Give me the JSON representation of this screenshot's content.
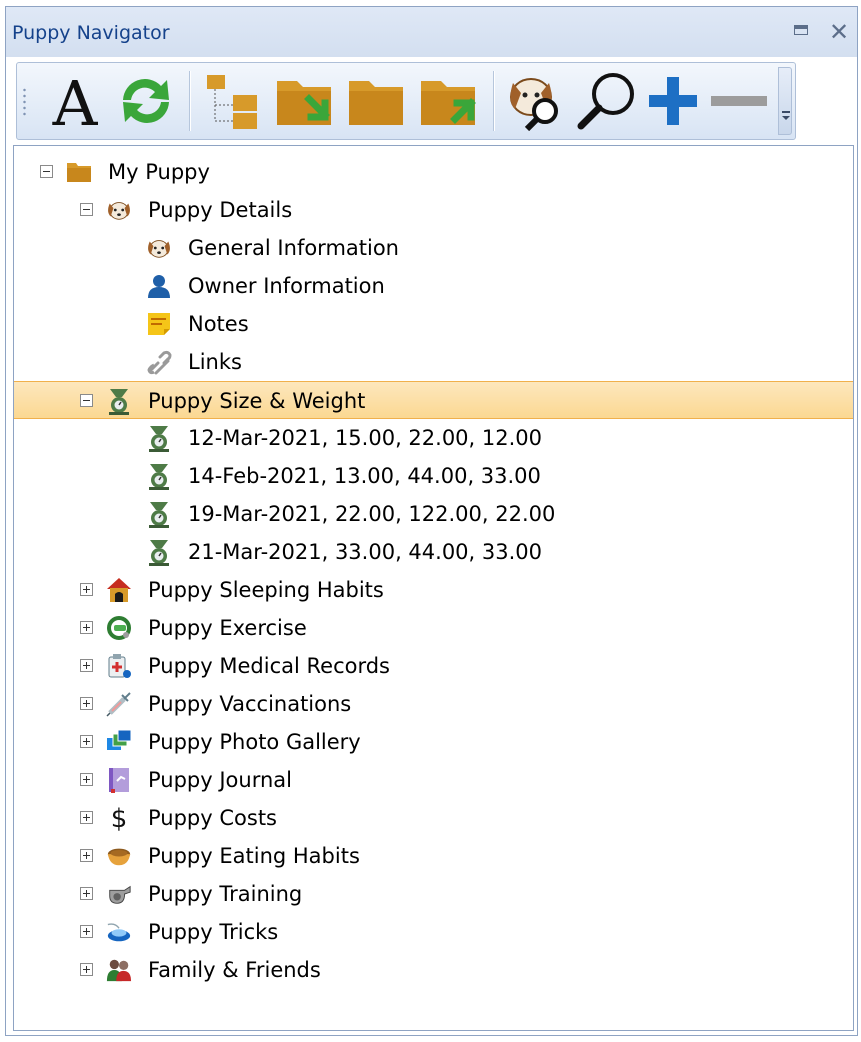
{
  "window": {
    "title": "Puppy Navigator",
    "menu_icon": "window-menu-icon",
    "close_label": "✕"
  },
  "toolbar": {
    "buttons": [
      {
        "name": "font-button",
        "icon": "font-a-icon"
      },
      {
        "name": "refresh-button",
        "icon": "refresh-icon"
      },
      {
        "name": "tree-view-button",
        "icon": "folder-tree-icon"
      },
      {
        "name": "import-button",
        "icon": "folder-import-icon"
      },
      {
        "name": "folder-button",
        "icon": "folder-icon"
      },
      {
        "name": "export-button",
        "icon": "folder-export-icon"
      },
      {
        "name": "puppy-search-button",
        "icon": "puppy-search-icon"
      },
      {
        "name": "search-button",
        "icon": "magnifier-icon"
      },
      {
        "name": "add-button",
        "icon": "plus-icon"
      },
      {
        "name": "remove-button",
        "icon": "minus-icon"
      }
    ],
    "accent_colors": {
      "blue": "#1d6fc4",
      "green": "#3aa63a",
      "folder": "#d79a2a"
    }
  },
  "tree": [
    {
      "label": "My Puppy",
      "level": 0,
      "expander": "minus",
      "icon": "folder-icon"
    },
    {
      "label": "Puppy Details",
      "level": 1,
      "expander": "minus",
      "icon": "puppy-face-icon"
    },
    {
      "label": "General Information",
      "level": 2,
      "expander": "none",
      "icon": "puppy-face-icon"
    },
    {
      "label": "Owner Information",
      "level": 2,
      "expander": "none",
      "icon": "person-icon"
    },
    {
      "label": "Notes",
      "level": 2,
      "expander": "none",
      "icon": "note-icon"
    },
    {
      "label": "Links",
      "level": 2,
      "expander": "none",
      "icon": "link-icon"
    },
    {
      "label": "Puppy Size & Weight",
      "level": 1,
      "expander": "minus",
      "icon": "scale-icon",
      "selected": true
    },
    {
      "label": "12-Mar-2021, 15.00, 22.00, 12.00",
      "level": 2,
      "expander": "none",
      "icon": "scale-icon"
    },
    {
      "label": "14-Feb-2021, 13.00, 44.00, 33.00",
      "level": 2,
      "expander": "none",
      "icon": "scale-icon"
    },
    {
      "label": "19-Mar-2021, 22.00, 122.00, 22.00",
      "level": 2,
      "expander": "none",
      "icon": "scale-icon"
    },
    {
      "label": "21-Mar-2021, 33.00, 44.00, 33.00",
      "level": 2,
      "expander": "none",
      "icon": "scale-icon"
    },
    {
      "label": "Puppy Sleeping Habits",
      "level": 1,
      "expander": "plus",
      "icon": "doghouse-icon"
    },
    {
      "label": "Puppy Exercise",
      "level": 1,
      "expander": "plus",
      "icon": "leash-icon"
    },
    {
      "label": "Puppy Medical Records",
      "level": 1,
      "expander": "plus",
      "icon": "medical-icon"
    },
    {
      "label": "Puppy Vaccinations",
      "level": 1,
      "expander": "plus",
      "icon": "syringe-icon"
    },
    {
      "label": "Puppy Photo Gallery",
      "level": 1,
      "expander": "plus",
      "icon": "photos-icon"
    },
    {
      "label": "Puppy Journal",
      "level": 1,
      "expander": "plus",
      "icon": "journal-icon"
    },
    {
      "label": "Puppy Costs",
      "level": 1,
      "expander": "plus",
      "icon": "dollar-icon"
    },
    {
      "label": "Puppy Eating Habits",
      "level": 1,
      "expander": "plus",
      "icon": "food-bowl-icon"
    },
    {
      "label": "Puppy Training",
      "level": 1,
      "expander": "plus",
      "icon": "whistle-icon"
    },
    {
      "label": "Puppy Tricks",
      "level": 1,
      "expander": "plus",
      "icon": "clicker-icon"
    },
    {
      "label": "Family & Friends",
      "level": 1,
      "expander": "plus",
      "icon": "people-icon"
    }
  ],
  "selection_color": "#fbd892"
}
